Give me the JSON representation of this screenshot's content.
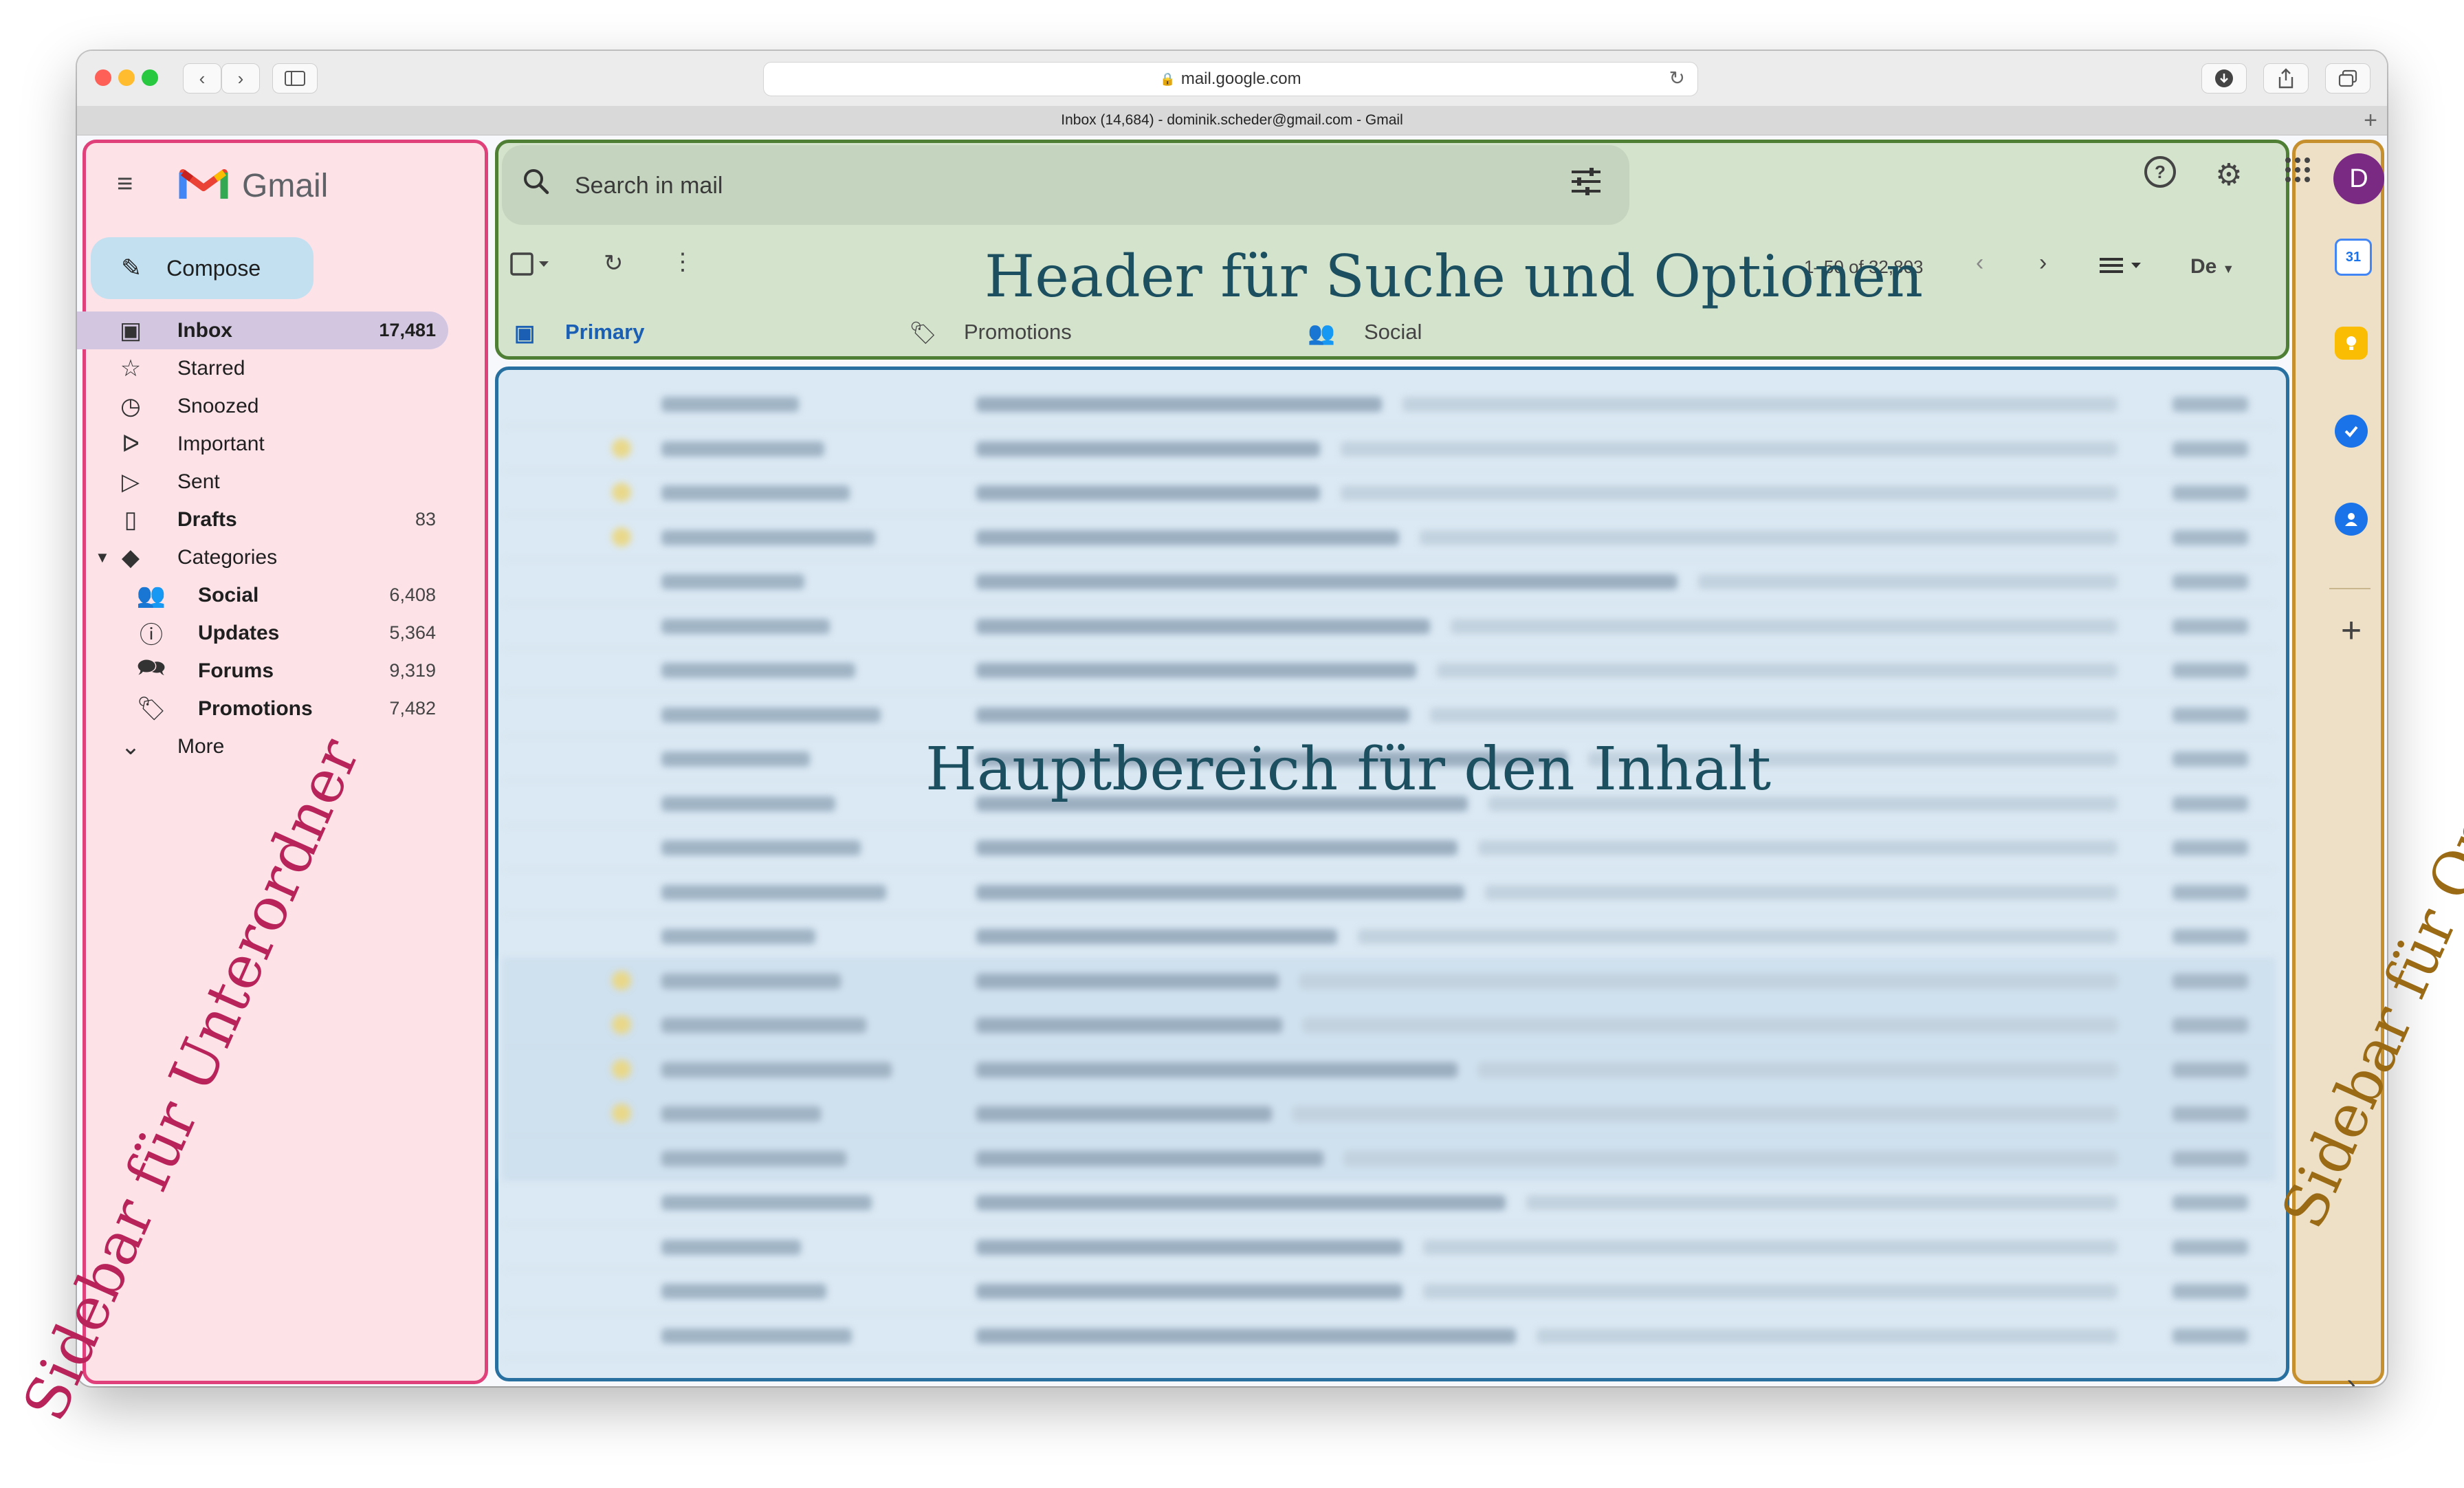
{
  "browser": {
    "url": "mail.google.com",
    "tab_title": "Inbox (14,684) - dominik.scheder@gmail.com - Gmail"
  },
  "app": {
    "name": "Gmail",
    "compose_label": "Compose"
  },
  "sidebar": {
    "items": [
      {
        "label": "Inbox",
        "count": "17,481",
        "icon": "inbox-icon"
      },
      {
        "label": "Starred",
        "count": "",
        "icon": "star-icon"
      },
      {
        "label": "Snoozed",
        "count": "",
        "icon": "clock-icon"
      },
      {
        "label": "Important",
        "count": "",
        "icon": "important-icon"
      },
      {
        "label": "Sent",
        "count": "",
        "icon": "send-icon"
      },
      {
        "label": "Drafts",
        "count": "83",
        "icon": "draft-icon"
      },
      {
        "label": "Categories",
        "count": "",
        "icon": "label-icon"
      },
      {
        "label": "Social",
        "count": "6,408",
        "icon": "people-icon"
      },
      {
        "label": "Updates",
        "count": "5,364",
        "icon": "info-icon"
      },
      {
        "label": "Forums",
        "count": "9,319",
        "icon": "forum-icon"
      },
      {
        "label": "Promotions",
        "count": "7,482",
        "icon": "tag-icon"
      },
      {
        "label": "More",
        "count": "",
        "icon": "chevron-down-icon"
      }
    ]
  },
  "header": {
    "search_placeholder": "Search in mail",
    "pagination": "1–50 of 32,803",
    "input_tools": "De",
    "tabs": [
      {
        "label": "Primary"
      },
      {
        "label": "Promotions"
      },
      {
        "label": "Social"
      }
    ]
  },
  "rail": {
    "avatar_initial": "D",
    "calendar_day": "31"
  },
  "annotations": {
    "left": "Sidebar für Unterordner",
    "header": "Header für Suche und Optionen",
    "main": "Hauptbereich für den Inhalt",
    "right": "Sidebar für Optionen"
  },
  "colors": {
    "left_zone": "#e1417a",
    "header_zone": "#4f7f34",
    "main_zone": "#2870a0",
    "right_zone": "#c7902f",
    "left_text": "#b8245a",
    "header_text": "#1c4f5f",
    "main_text": "#1c4f5f",
    "right_text": "#9a6a14"
  }
}
